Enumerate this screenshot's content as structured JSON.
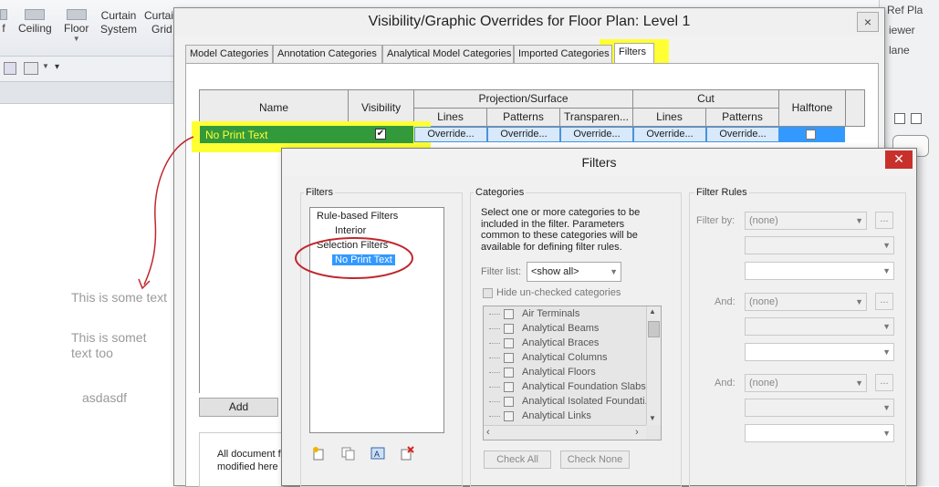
{
  "ribbon": {
    "items": [
      {
        "label": "f"
      },
      {
        "label": "Ceiling"
      },
      {
        "label": "Floor"
      },
      {
        "label": "Curtain\nSystem"
      },
      {
        "label": "Curtain\nGrid"
      }
    ]
  },
  "right_panel": {
    "items": [
      "Ref Pla",
      "iewer",
      "lane"
    ]
  },
  "canvas": {
    "text1": "This is some text",
    "text2_line1": "This is somet",
    "text2_line2": "text too",
    "text3": "asdasdf"
  },
  "vg_dialog": {
    "title": "Visibility/Graphic Overrides for Floor Plan: Level 1",
    "close_glyph": "×",
    "tabs": [
      "Model Categories",
      "Annotation Categories",
      "Analytical Model Categories",
      "Imported Categories",
      "Filters"
    ],
    "columns": {
      "name": "Name",
      "visibility": "Visibility",
      "projection_surface": "Projection/Surface",
      "cut": "Cut",
      "halftone": "Halftone",
      "lines": "Lines",
      "patterns": "Patterns",
      "transparency": "Transparen..."
    },
    "row": {
      "name": "No Print Text",
      "visible": true,
      "override": "Override...",
      "halftone": false
    },
    "add_button": "Add",
    "footer_line1": "All document f",
    "footer_line2": "modified here"
  },
  "filters_dialog": {
    "title": "Filters",
    "close_glyph": "✕",
    "filters_group": "Filters",
    "tree": {
      "rule_based": "Rule-based Filters",
      "interior": "Interior",
      "selection": "Selection Filters",
      "selected_item": "No Print Text"
    },
    "categories_group": "Categories",
    "categories_help": "Select one or more categories to be included in the filter.  Parameters common to these categories will be available for defining filter rules.",
    "filter_list_label": "Filter list:",
    "filter_list_value": "<show all>",
    "hide_unchecked": "Hide un-checked categories",
    "categories": [
      "Air Terminals",
      "Analytical Beams",
      "Analytical Braces",
      "Analytical Columns",
      "Analytical Floors",
      "Analytical Foundation Slabs",
      "Analytical Isolated Foundati..",
      "Analytical Links"
    ],
    "check_all": "Check All",
    "check_none": "Check None",
    "rules_group": "Filter Rules",
    "filter_by_label": "Filter by:",
    "and_label": "And:",
    "none_value": "(none)",
    "ellipsis": "..."
  },
  "colors": {
    "highlight_yellow": "#ffff33",
    "row_green": "#339a3c",
    "annotation_red": "#c0272d",
    "selection_blue": "#3399ff"
  }
}
